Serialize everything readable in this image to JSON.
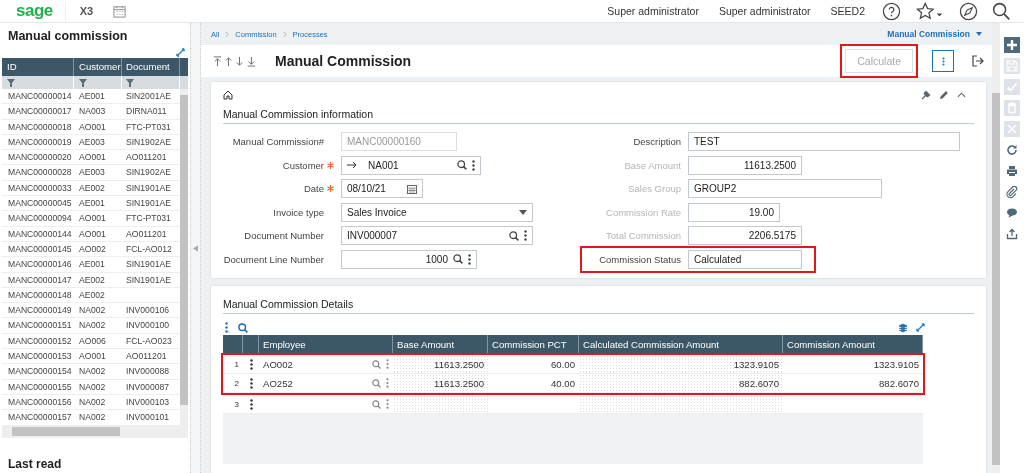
{
  "top_bar": {
    "logo": "sage",
    "product": "X3",
    "user_1": "Super administrator",
    "user_2": "Super administrator",
    "folder": "SEED2"
  },
  "left_panel": {
    "title": "Manual commission",
    "columns": [
      "ID",
      "Customer",
      "Document"
    ],
    "rows": [
      {
        "id": "MANC00000014",
        "customer": "AE001",
        "document": "SIN2001AE"
      },
      {
        "id": "MANC00000017",
        "customer": "NA003",
        "document": "DIRNA011"
      },
      {
        "id": "MANC00000018",
        "customer": "AO001",
        "document": "FTC-PT031"
      },
      {
        "id": "MANC00000019",
        "customer": "AE003",
        "document": "SIN1902AE"
      },
      {
        "id": "MANC00000020",
        "customer": "AO001",
        "document": "AO011201"
      },
      {
        "id": "MANC00000028",
        "customer": "AE003",
        "document": "SIN1902AE"
      },
      {
        "id": "MANC00000033",
        "customer": "AE002",
        "document": "SIN1901AE"
      },
      {
        "id": "MANC00000045",
        "customer": "AE001",
        "document": "SIN1901AE"
      },
      {
        "id": "MANC00000094",
        "customer": "AO001",
        "document": "FTC-PT031"
      },
      {
        "id": "MANC00000144",
        "customer": "AO001",
        "document": "AO011201"
      },
      {
        "id": "MANC00000145",
        "customer": "AO002",
        "document": "FCL-AO012"
      },
      {
        "id": "MANC00000146",
        "customer": "AE001",
        "document": "SIN1901AE"
      },
      {
        "id": "MANC00000147",
        "customer": "AE002",
        "document": "SIN1901AE"
      },
      {
        "id": "MANC00000148",
        "customer": "AE002"
      },
      {
        "id": "MANC00000149",
        "customer": "NA002",
        "document": "INV000106"
      },
      {
        "id": "MANC00000151",
        "customer": "NA002",
        "document": "INV000100"
      },
      {
        "id": "MANC00000152",
        "customer": "AO006",
        "document": "FCL-AO023"
      },
      {
        "id": "MANC00000153",
        "customer": "AO001",
        "document": "AO011201"
      },
      {
        "id": "MANC00000154",
        "customer": "NA002",
        "document": "INV000088"
      },
      {
        "id": "MANC00000155",
        "customer": "NA002",
        "document": "INV000087"
      },
      {
        "id": "MANC00000156",
        "customer": "NA002",
        "document": "INV000103"
      },
      {
        "id": "MANC00000157",
        "customer": "NA002",
        "document": "INV000101"
      }
    ],
    "footer": "Last read"
  },
  "breadcrumb": [
    "All",
    "Commission",
    "Processes"
  ],
  "function_menu": "Manual Commission",
  "page_title": "Manual Commission",
  "calculate_button": {
    "label": "Calculate",
    "disabled": true,
    "highlighted": true
  },
  "info_section": {
    "title": "Manual Commission information",
    "left_fields": [
      {
        "label": "Manual Commission#",
        "value": "MANC00000160",
        "kind": "text",
        "disabled": true,
        "required": false
      },
      {
        "label": "Customer",
        "value": "NA001",
        "kind": "link",
        "disabled": false,
        "required": true
      },
      {
        "label": "Date",
        "value": "08/10/21",
        "kind": "date",
        "disabled": false,
        "required": true
      },
      {
        "label": "Invoice type",
        "value": "Sales Invoice",
        "kind": "select",
        "disabled": false,
        "required": false
      },
      {
        "label": "Document Number",
        "value": "INV000007",
        "kind": "lookup",
        "disabled": false,
        "required": false
      },
      {
        "label": "Document Line Number",
        "value": "1000",
        "kind": "lookup_number",
        "disabled": false,
        "required": false
      }
    ],
    "right_fields": [
      {
        "label": "Description",
        "value": "TEST",
        "kind": "text",
        "disabled": false,
        "highlighted": false
      },
      {
        "label": "Base Amount",
        "value": "11613.2500",
        "kind": "number",
        "disabled": true,
        "highlighted": false
      },
      {
        "label": "Sales Group",
        "value": "GROUP2",
        "kind": "text",
        "disabled": true,
        "highlighted": false
      },
      {
        "label": "Commission Rate",
        "value": "19.00",
        "kind": "number",
        "disabled": true,
        "highlighted": false
      },
      {
        "label": "Total Commission",
        "value": "2206.5175",
        "kind": "number",
        "disabled": true,
        "highlighted": false
      },
      {
        "label": "Commission Status",
        "value": "Calculated",
        "kind": "text",
        "disabled": false,
        "highlighted": true
      }
    ]
  },
  "details_section": {
    "title": "Manual Commission Details",
    "columns": [
      "Employee",
      "Base Amount",
      "Commission PCT",
      "Calculated Commission Amount",
      "Commission Amount"
    ],
    "rows_highlighted": true,
    "rows": [
      {
        "num": "1",
        "employee": "AO002",
        "base_amount": "11613.2500",
        "commission_pct": "60.00",
        "calculated": "1323.9105",
        "commission_amount": "1323.9105"
      },
      {
        "num": "2",
        "employee": "AO252",
        "base_amount": "11613.2500",
        "commission_pct": "40.00",
        "calculated": "882.6070",
        "commission_amount": "882.6070"
      },
      {
        "num": "3"
      }
    ]
  },
  "right_toolbar": [
    {
      "kind": "add",
      "disabled": false
    },
    {
      "kind": "save",
      "disabled": true
    },
    {
      "kind": "check",
      "disabled": true
    },
    {
      "kind": "delete",
      "disabled": true
    },
    {
      "kind": "cancel",
      "disabled": true
    },
    {
      "kind": "refresh",
      "disabled": false
    },
    {
      "kind": "print",
      "disabled": false
    },
    {
      "kind": "attach",
      "disabled": false
    },
    {
      "kind": "comment",
      "disabled": false
    },
    {
      "kind": "share",
      "disabled": false
    }
  ]
}
